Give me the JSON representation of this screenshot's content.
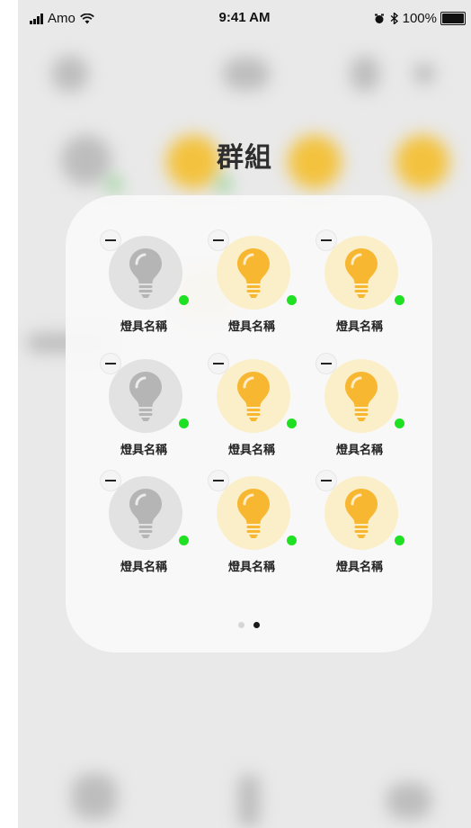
{
  "status_bar": {
    "carrier": "Amo",
    "time": "9:41 AM",
    "battery": "100%"
  },
  "group": {
    "title": "群組"
  },
  "lamps": [
    {
      "label": "燈具名稱",
      "state": "off",
      "online": true
    },
    {
      "label": "燈具名稱",
      "state": "on",
      "online": true
    },
    {
      "label": "燈具名稱",
      "state": "on",
      "online": true
    },
    {
      "label": "燈具名稱",
      "state": "off",
      "online": true
    },
    {
      "label": "燈具名稱",
      "state": "on",
      "online": true
    },
    {
      "label": "燈具名稱",
      "state": "on",
      "online": true
    },
    {
      "label": "燈具名稱",
      "state": "off",
      "online": true
    },
    {
      "label": "燈具名稱",
      "state": "on",
      "online": true
    },
    {
      "label": "燈具名稱",
      "state": "on",
      "online": true
    }
  ],
  "pagination": {
    "total_pages": 2,
    "current_page": 2
  },
  "colors": {
    "bulb_on": "#f7b731",
    "bulb_off": "#b5b5b5",
    "online": "#1fe023"
  }
}
